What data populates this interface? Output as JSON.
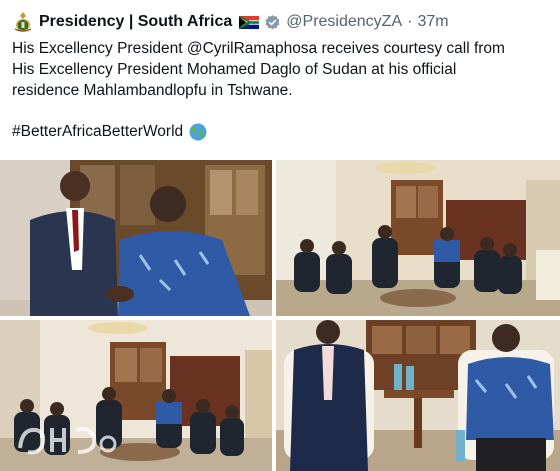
{
  "tweet": {
    "display_name": "Presidency | South Africa",
    "handle": "@PresidencyZA",
    "separator": "·",
    "time": "37m",
    "text_lines": [
      "His Excellency President @CyrilRamaphosa receives courtesy call  from",
      "His Excellency President Mohamed Daglo of Sudan at his official",
      "residence Mahlambandlopfu in Tshwane."
    ],
    "hashtag": "#BetterAfricaBetterWorld"
  },
  "icons": {
    "avatar": "coat-of-arms-icon",
    "flag": "south-africa-flag-icon",
    "verified": "verified-badge-icon",
    "globe": "globe-emoji-icon"
  },
  "colors": {
    "text": "#0f1419",
    "secondary": "#536471",
    "verified": "#829aab"
  }
}
